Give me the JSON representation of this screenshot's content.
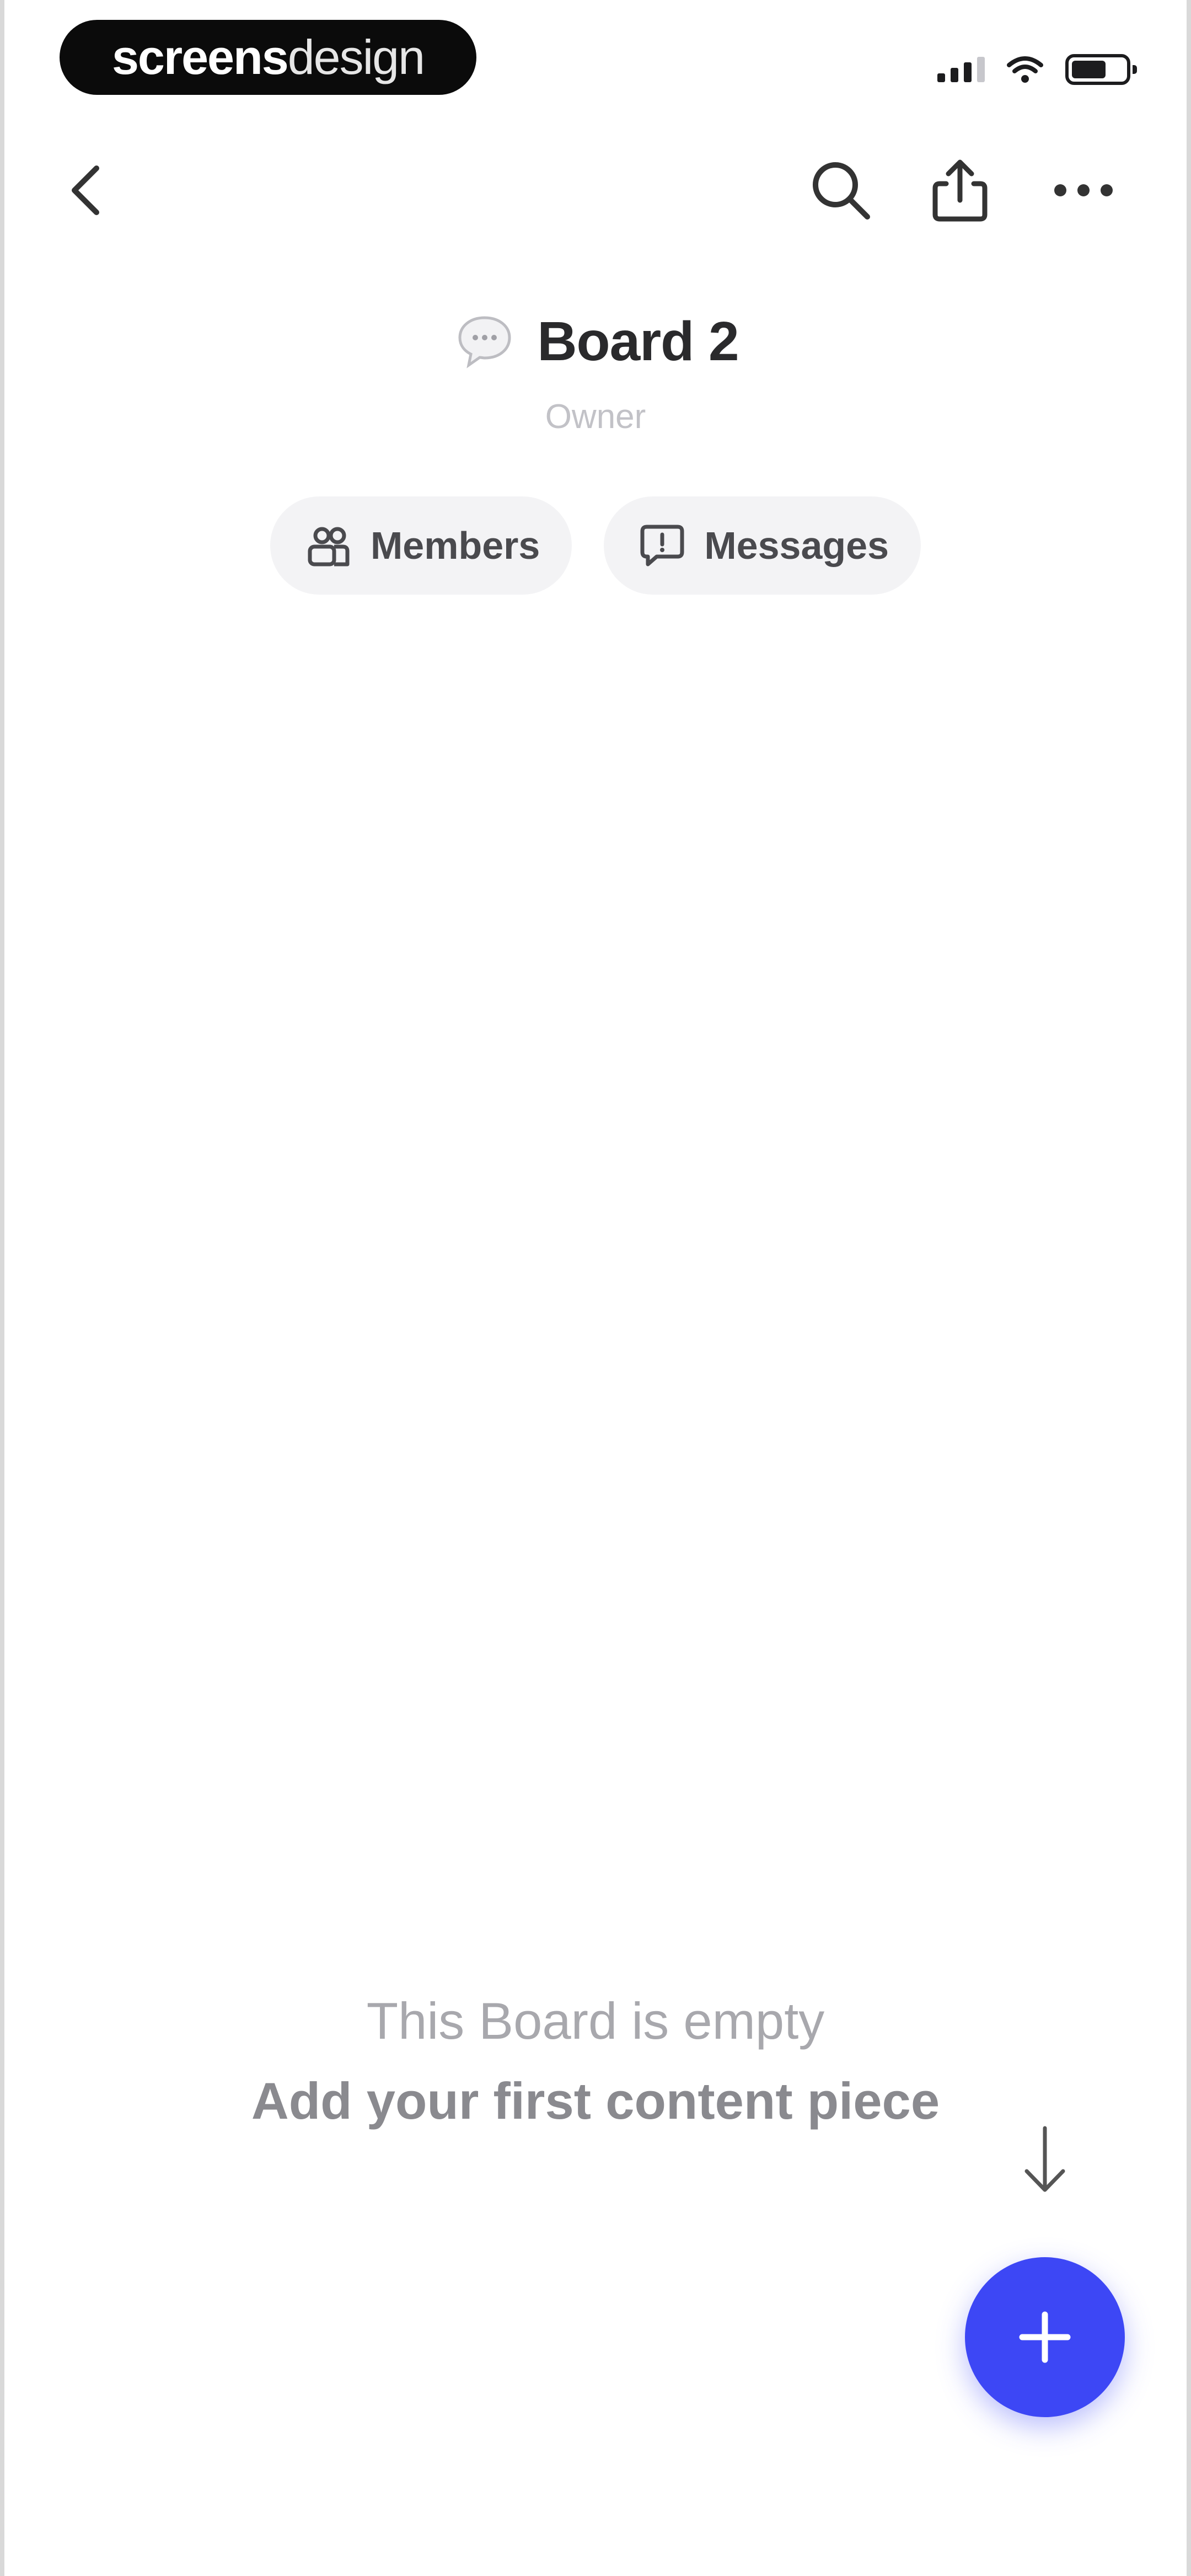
{
  "status_bar": {
    "brand_part1": "screens",
    "brand_part2": "design",
    "icons": [
      "cellular-signal-icon",
      "wifi-icon",
      "battery-icon"
    ]
  },
  "nav": {
    "icons": [
      "chevron-left-icon",
      "search-icon",
      "share-icon",
      "more-horizontal-icon"
    ]
  },
  "board": {
    "icon": "speech-bubble-icon",
    "title": "Board 2",
    "role": "Owner"
  },
  "chips": {
    "members": {
      "label": "Members",
      "icon": "members-icon"
    },
    "messages": {
      "label": "Messages",
      "icon": "message-square-icon"
    }
  },
  "empty_state": {
    "title": "This Board is empty",
    "subtitle": "Add your first content piece",
    "hint_icon": "arrow-down-icon"
  },
  "fab": {
    "icon": "plus-icon"
  },
  "colors": {
    "accent": "#3d47f5",
    "background": "#ffffff",
    "chip_bg": "#f3f3f5",
    "text_primary": "#2a2a2c",
    "text_muted": "#a8a8ad"
  }
}
